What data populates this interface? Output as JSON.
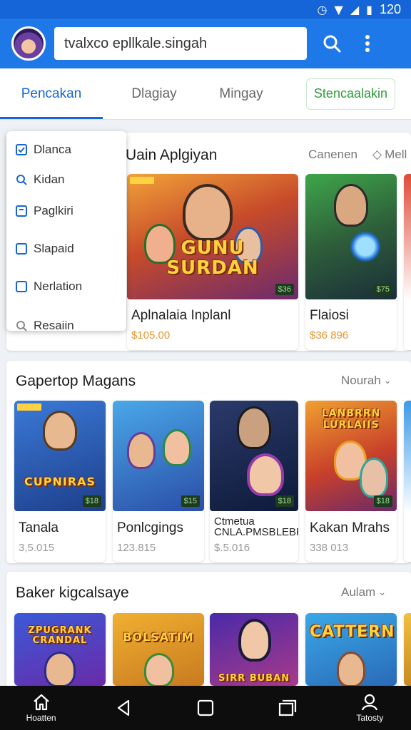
{
  "status_bar": {
    "time": "120"
  },
  "app_bar": {
    "search_value": "tvalxco epllkale.singah"
  },
  "tabs": [
    {
      "label": "Pencakan"
    },
    {
      "label": "Dlagiay"
    },
    {
      "label": "Mingay"
    },
    {
      "label": "Stencaalakin"
    }
  ],
  "menu": {
    "items": [
      {
        "label": "Dlanca"
      },
      {
        "label": "Kidan"
      },
      {
        "label": "Paglkiri"
      },
      {
        "label": "Slapaid"
      },
      {
        "label": "Nerlation"
      },
      {
        "label": "Resaiin"
      }
    ]
  },
  "sections": [
    {
      "title": "Uain Aplgiyan",
      "link": "Canenen",
      "link2": "Mell",
      "items": [
        {
          "logo": "GUNU\nSURDAN",
          "name": "Aplnalaia Inplanl",
          "sub": "$105.00",
          "badge": "$36"
        },
        {
          "logo": "",
          "name": "Flaiosi",
          "sub": "$36 896",
          "badge": "$75"
        }
      ]
    },
    {
      "title": "Gapertop Magans",
      "link": "Nourah",
      "items": [
        {
          "logo": "CUPNIRAS",
          "name": "Tanala",
          "sub": "3,5.015",
          "badge": "$18"
        },
        {
          "logo": "",
          "name": "Ponlcgings",
          "sub": "123.815",
          "badge": "$15"
        },
        {
          "logo": "",
          "name": "Ctmetua\nCNLA.PMSBLEBRO",
          "sub": "$.5.016",
          "badge": "$18"
        },
        {
          "logo": "LANBRRN\nLURLAIIS",
          "name": "Kakan Mrahs",
          "sub": "338 013",
          "badge": "$18"
        }
      ]
    },
    {
      "title": "Baker kigcalsaye",
      "link": "Aulam",
      "items": [
        {
          "logo": "ZPUGRANK\nCRANDAL",
          "name": "",
          "sub": "",
          "badge": ""
        },
        {
          "logo": "BOLSATIM",
          "name": "",
          "sub": "",
          "badge": ""
        },
        {
          "logo": "SIRR BUBAN",
          "name": "",
          "sub": "",
          "badge": ""
        },
        {
          "logo": "CATTERN",
          "name": "",
          "sub": "",
          "badge": ""
        }
      ]
    }
  ],
  "nav_bar": {
    "home_label": "Hoatten",
    "account_label": "Tatosty"
  },
  "colors": {
    "primary": "#1f78e8",
    "accent_green": "#2e9c3a",
    "price_orange": "#e8962e"
  }
}
